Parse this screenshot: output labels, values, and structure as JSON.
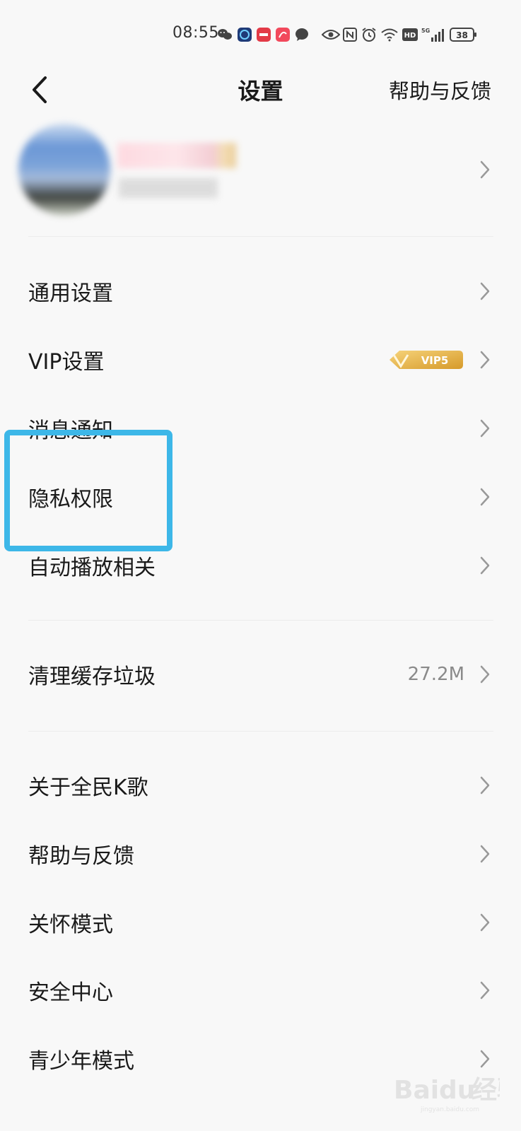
{
  "status_bar": {
    "time": "08:55",
    "network": "5G",
    "battery": "38",
    "icons": [
      "wechat-icon",
      "app-icon",
      "app-icon",
      "app-icon",
      "message-icon",
      "eye-icon",
      "nfc-icon",
      "alarm-icon",
      "wifi-icon",
      "hd-icon",
      "signal-icon",
      "battery-icon"
    ]
  },
  "nav": {
    "title": "设置",
    "help_label": "帮助与反馈",
    "back_icon": "back-icon"
  },
  "profile": {
    "chevron_icon": "chevron-right-icon"
  },
  "menu": {
    "general": {
      "label": "通用设置"
    },
    "vip": {
      "label": "VIP设置",
      "badge_text": "VIP5",
      "badge_color": "#e7b44a"
    },
    "notifications": {
      "label": "消息通知"
    },
    "privacy": {
      "label": "隐私权限"
    },
    "autoplay": {
      "label": "自动播放相关"
    },
    "cache": {
      "label": "清理缓存垃圾",
      "value": "27.2M"
    },
    "about": {
      "label": "关于全民K歌"
    },
    "help": {
      "label": "帮助与反馈"
    },
    "care_mode": {
      "label": "关怀模式"
    },
    "security": {
      "label": "安全中心"
    },
    "teen_mode": {
      "label": "青少年模式"
    }
  },
  "annotation": {
    "highlight_color": "#3db7e8"
  },
  "watermark": {
    "text": "Bai",
    "text2": "du",
    "text3": "经验",
    "url": "jingyan.baidu.com"
  }
}
